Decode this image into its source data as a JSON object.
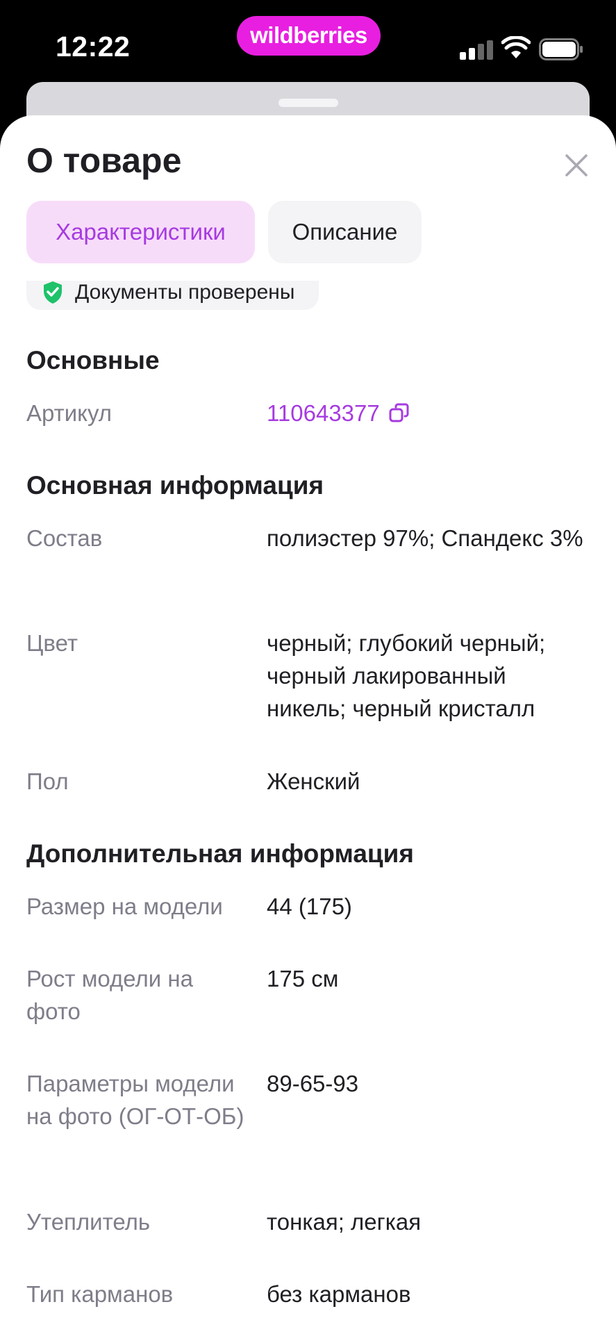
{
  "status_bar": {
    "time": "12:22",
    "brand": "wildberries",
    "brand_color": "#e81fe0"
  },
  "sheet": {
    "title": "О товаре",
    "close_icon": "close-icon",
    "tabs": [
      {
        "label": "Характеристики",
        "active": true
      },
      {
        "label": "Описание",
        "active": false
      }
    ],
    "docs_badge": "Документы проверены",
    "accent_color": "#a63be0"
  },
  "sections": {
    "basic": {
      "title": "Основные",
      "rows": [
        {
          "label": "Артикул",
          "value": "110643377"
        }
      ]
    },
    "main_info": {
      "title": "Основная информация",
      "rows": [
        {
          "label": "Состав",
          "value": "полиэстер 97%; Спандекс 3%"
        },
        {
          "label": "Цвет",
          "value": "черный; глубокий черный; черный лакированный никель; черный кристалл"
        },
        {
          "label": "Пол",
          "value": "Женский"
        }
      ]
    },
    "extra_info": {
      "title": "Дополнительная информация",
      "rows": [
        {
          "label": "Размер на модели",
          "value": "44 (175)"
        },
        {
          "label": "Рост модели на фото",
          "value": "175 см"
        },
        {
          "label": "Параметры модели на фото (ОГ-ОТ-ОБ)",
          "value": "89-65-93"
        },
        {
          "label": "Утеплитель",
          "value": "тонкая; легкая"
        },
        {
          "label": "Тип карманов",
          "value": "без карманов"
        }
      ]
    }
  }
}
